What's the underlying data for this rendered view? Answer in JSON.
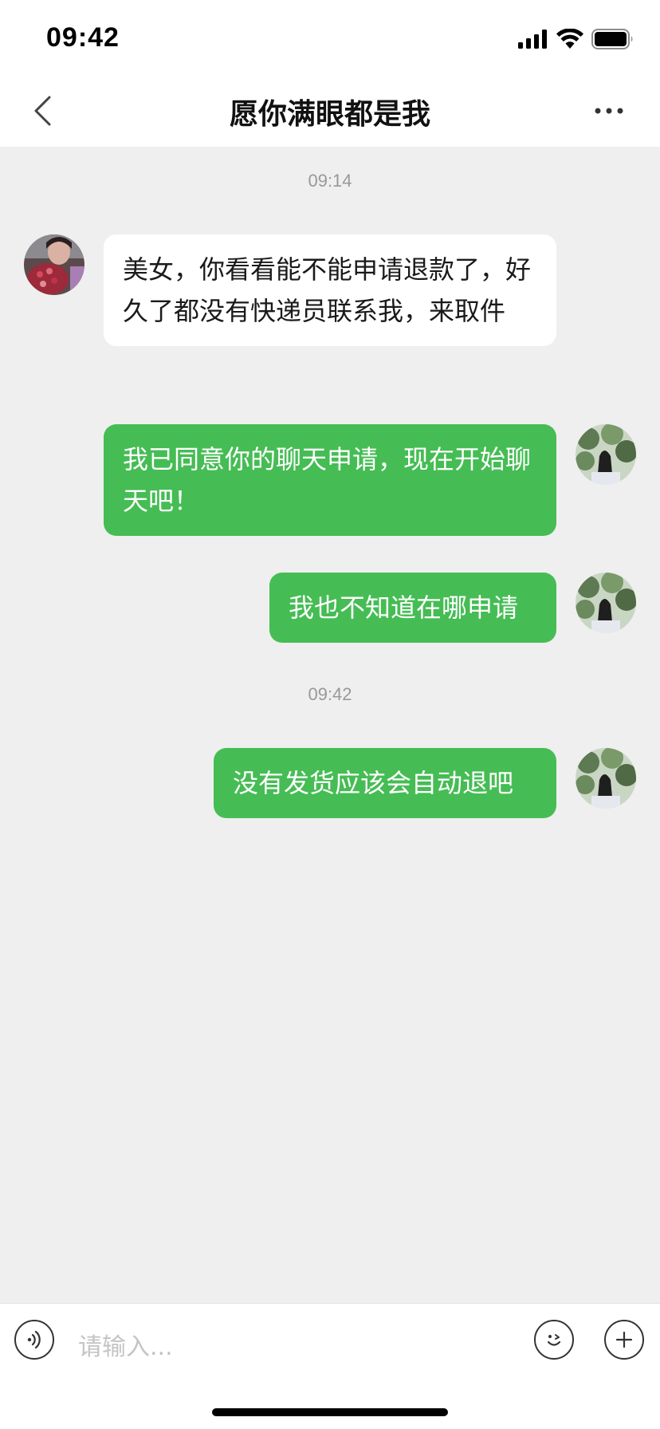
{
  "status_bar": {
    "time": "09:42"
  },
  "header": {
    "title": "愿你满眼都是我"
  },
  "chat": {
    "timestamps": [
      "09:14",
      "09:42"
    ],
    "messages": [
      {
        "sender": "contact",
        "text": "美女，你看看能不能申请退款了，好久了都没有快递员联系我，来取件"
      },
      {
        "sender": "me",
        "text": "我已同意你的聊天申请，现在开始聊天吧！"
      },
      {
        "sender": "me",
        "text": "我也不知道在哪申请"
      },
      {
        "sender": "me",
        "text": "没有发货应该会自动退吧"
      }
    ]
  },
  "input": {
    "placeholder": "请输入..."
  },
  "colors": {
    "outgoing_bubble": "#45bd54",
    "incoming_bubble": "#ffffff",
    "chat_background": "#efefef"
  }
}
